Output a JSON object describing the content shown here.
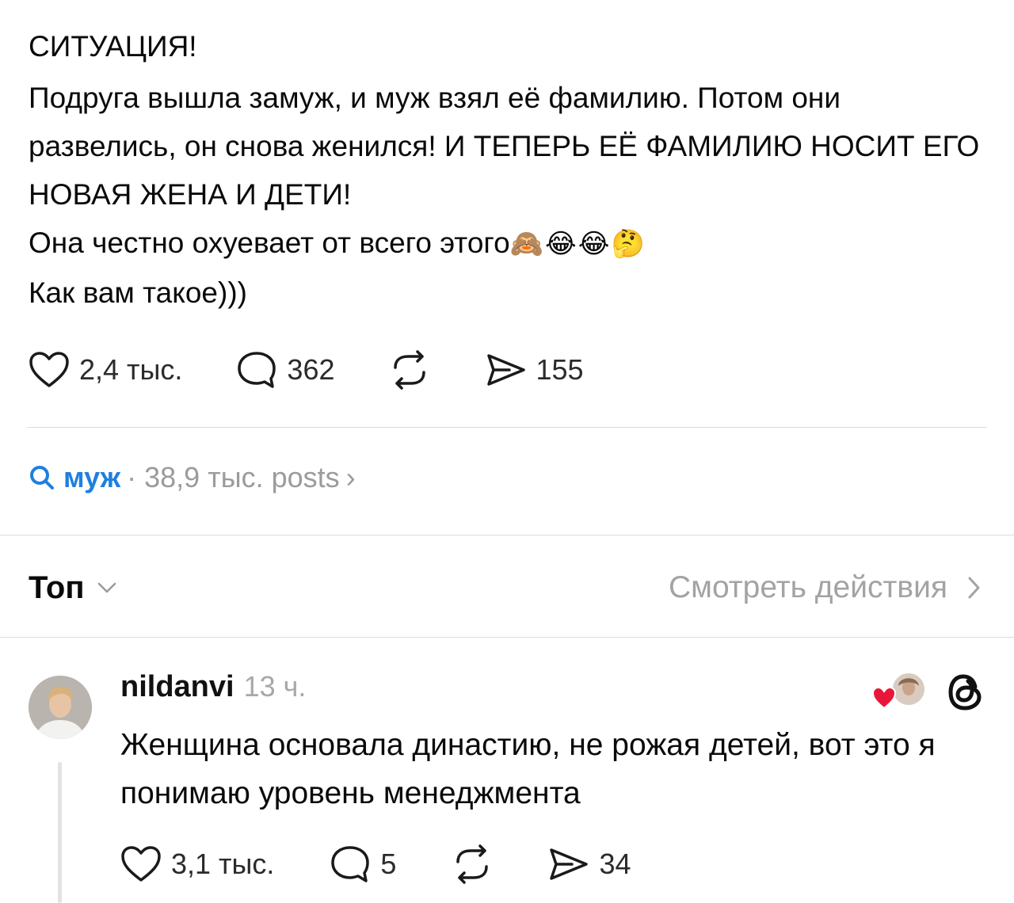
{
  "post": {
    "title_line": "СИТУАЦИЯ!",
    "body_line_1": "Подруга вышла замуж, и муж взял её фамилию. Потом они развелись, он снова женился! И ТЕПЕРЬ ЕЁ ФАМИЛИЮ НОСИТ ЕГО НОВАЯ ЖЕНА И ДЕТИ!",
    "body_line_2": "Она честно охуевает от всего этого",
    "body_emojis": "🙈😂😂🤔",
    "body_line_3": "Как вам такое)))",
    "likes": "2,4 тыс.",
    "comments": "362",
    "shares": "155"
  },
  "topic": {
    "tag": "муж",
    "meta": "· 38,9 тыс. posts",
    "chevron": "›"
  },
  "sort": {
    "label": "Топ",
    "view_activity": "Смотреть действия"
  },
  "comment": {
    "username": "nildanvi",
    "time": "13 ч.",
    "text": "Женщина основала династию, не рожая детей, вот это я понимаю уровень менеджмента",
    "likes": "3,1 тыс.",
    "comments": "5",
    "shares": "34"
  },
  "icons": {
    "like": "heart-icon",
    "comment": "comment-bubble-icon",
    "repost": "repost-icon",
    "share": "send-icon",
    "search": "search-icon",
    "threads": "threads-logo-icon"
  },
  "colors": {
    "topic_accent": "#1f7fe0",
    "liked_heart": "#e8173a"
  }
}
